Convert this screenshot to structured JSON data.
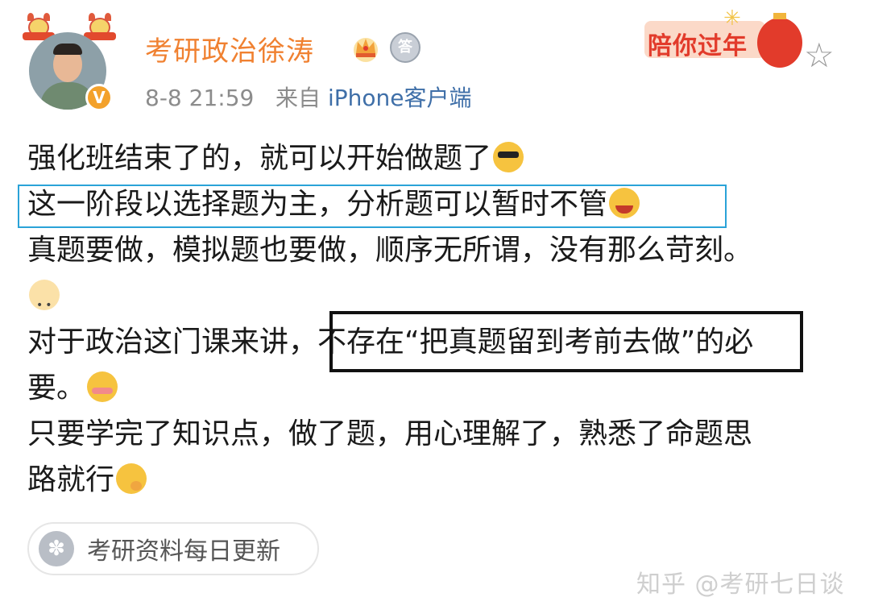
{
  "user": {
    "name": "考研政治徐涛",
    "verified_badge": "V",
    "medal_char": "答"
  },
  "meta": {
    "time": "8-8 21:59",
    "from_label": "来自",
    "source": "iPhone客户端"
  },
  "decoration": {
    "new_year_label": "陪你过年"
  },
  "post": {
    "lines": [
      "强化班结束了的，就可以开始做题了",
      "这一阶段以选择题为主，分析题可以暂时不管",
      "真题要做，模拟题也要做，顺序无所谓，没有那么苛刻。",
      "对于政治这门课来讲，不存在“把真题留到考前去做”的必",
      "要。",
      "只要学完了知识点，做了题，用心理解了，熟悉了命题思",
      "路就行"
    ]
  },
  "topic": {
    "label": "考研资料每日更新"
  },
  "watermark": "知乎 @考研七日谈",
  "colors": {
    "username": "#f08131",
    "source_link": "#3f6fa8",
    "highlight_box": "#2aa3d8",
    "emphasis_box": "#111111"
  },
  "icons": [
    "crown-icon",
    "medal-icon",
    "star-icon",
    "cool-emoji",
    "crying-emoji",
    "sad-emoji",
    "shy-emoji",
    "thinking-emoji",
    "topic-icon"
  ]
}
